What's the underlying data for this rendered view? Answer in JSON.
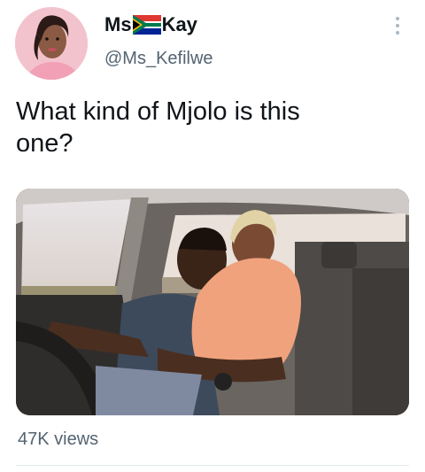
{
  "author": {
    "name_before_flag": "Ms",
    "flag_icon": "south-africa-flag-icon",
    "name_after_flag": "Kay",
    "handle": "@Ms_Kefilwe"
  },
  "tweet": {
    "text": "What kind of Mjolo is this\none?",
    "media_icon": "video-thumbnail",
    "views": "47K views"
  },
  "colors": {
    "text": "#0f1419",
    "secondary_text": "#536471",
    "divider": "#e1e8ed"
  }
}
